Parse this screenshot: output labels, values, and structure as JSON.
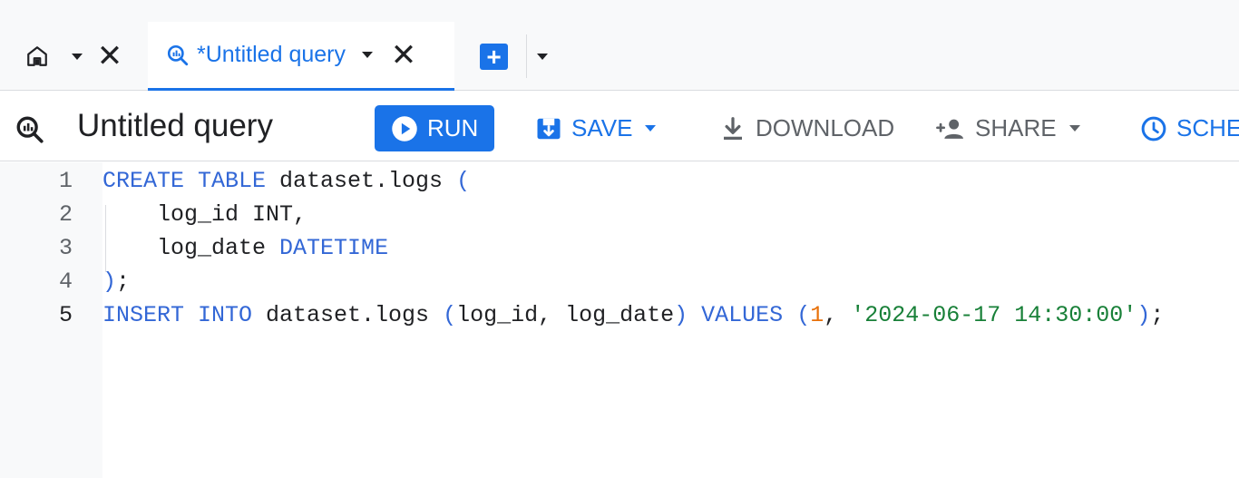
{
  "tabs": [
    {
      "name": "home",
      "close_label": "✕"
    },
    {
      "name": "query",
      "label": "*Untitled query",
      "close_label": "✕",
      "active": true
    }
  ],
  "add_tab_label": "+",
  "toolbar": {
    "title": "Untitled query",
    "run_label": "RUN",
    "save_label": "SAVE",
    "download_label": "DOWNLOAD",
    "share_label": "SHARE",
    "schedule_label": "SCHE"
  },
  "colors": {
    "accent": "#1a73e8",
    "keyword": "#3367d6",
    "number": "#e8710a",
    "string": "#188038"
  },
  "editor": {
    "active_line": 5,
    "lines": [
      {
        "n": "1",
        "tokens": [
          {
            "t": "CREATE TABLE",
            "c": "kw"
          },
          {
            "t": " dataset.logs ",
            "c": ""
          },
          {
            "t": "(",
            "c": "kw"
          }
        ]
      },
      {
        "n": "2",
        "tokens": [
          {
            "t": "    log_id INT,",
            "c": ""
          }
        ]
      },
      {
        "n": "3",
        "tokens": [
          {
            "t": "    log_date ",
            "c": ""
          },
          {
            "t": "DATETIME",
            "c": "kw"
          }
        ]
      },
      {
        "n": "4",
        "tokens": [
          {
            "t": ")",
            "c": "kw"
          },
          {
            "t": ";",
            "c": ""
          }
        ]
      },
      {
        "n": "5",
        "tokens": [
          {
            "t": "INSERT INTO",
            "c": "kw"
          },
          {
            "t": " dataset.logs ",
            "c": ""
          },
          {
            "t": "(",
            "c": "kw"
          },
          {
            "t": "log_id, log_date",
            "c": ""
          },
          {
            "t": ")",
            "c": "kw"
          },
          {
            "t": " ",
            "c": ""
          },
          {
            "t": "VALUES",
            "c": "kw"
          },
          {
            "t": " ",
            "c": ""
          },
          {
            "t": "(",
            "c": "kw"
          },
          {
            "t": "1",
            "c": "num"
          },
          {
            "t": ", ",
            "c": ""
          },
          {
            "t": "'2024-06-17 14:30:00'",
            "c": "str"
          },
          {
            "t": ")",
            "c": "kw"
          },
          {
            "t": ";",
            "c": ""
          }
        ]
      }
    ]
  }
}
